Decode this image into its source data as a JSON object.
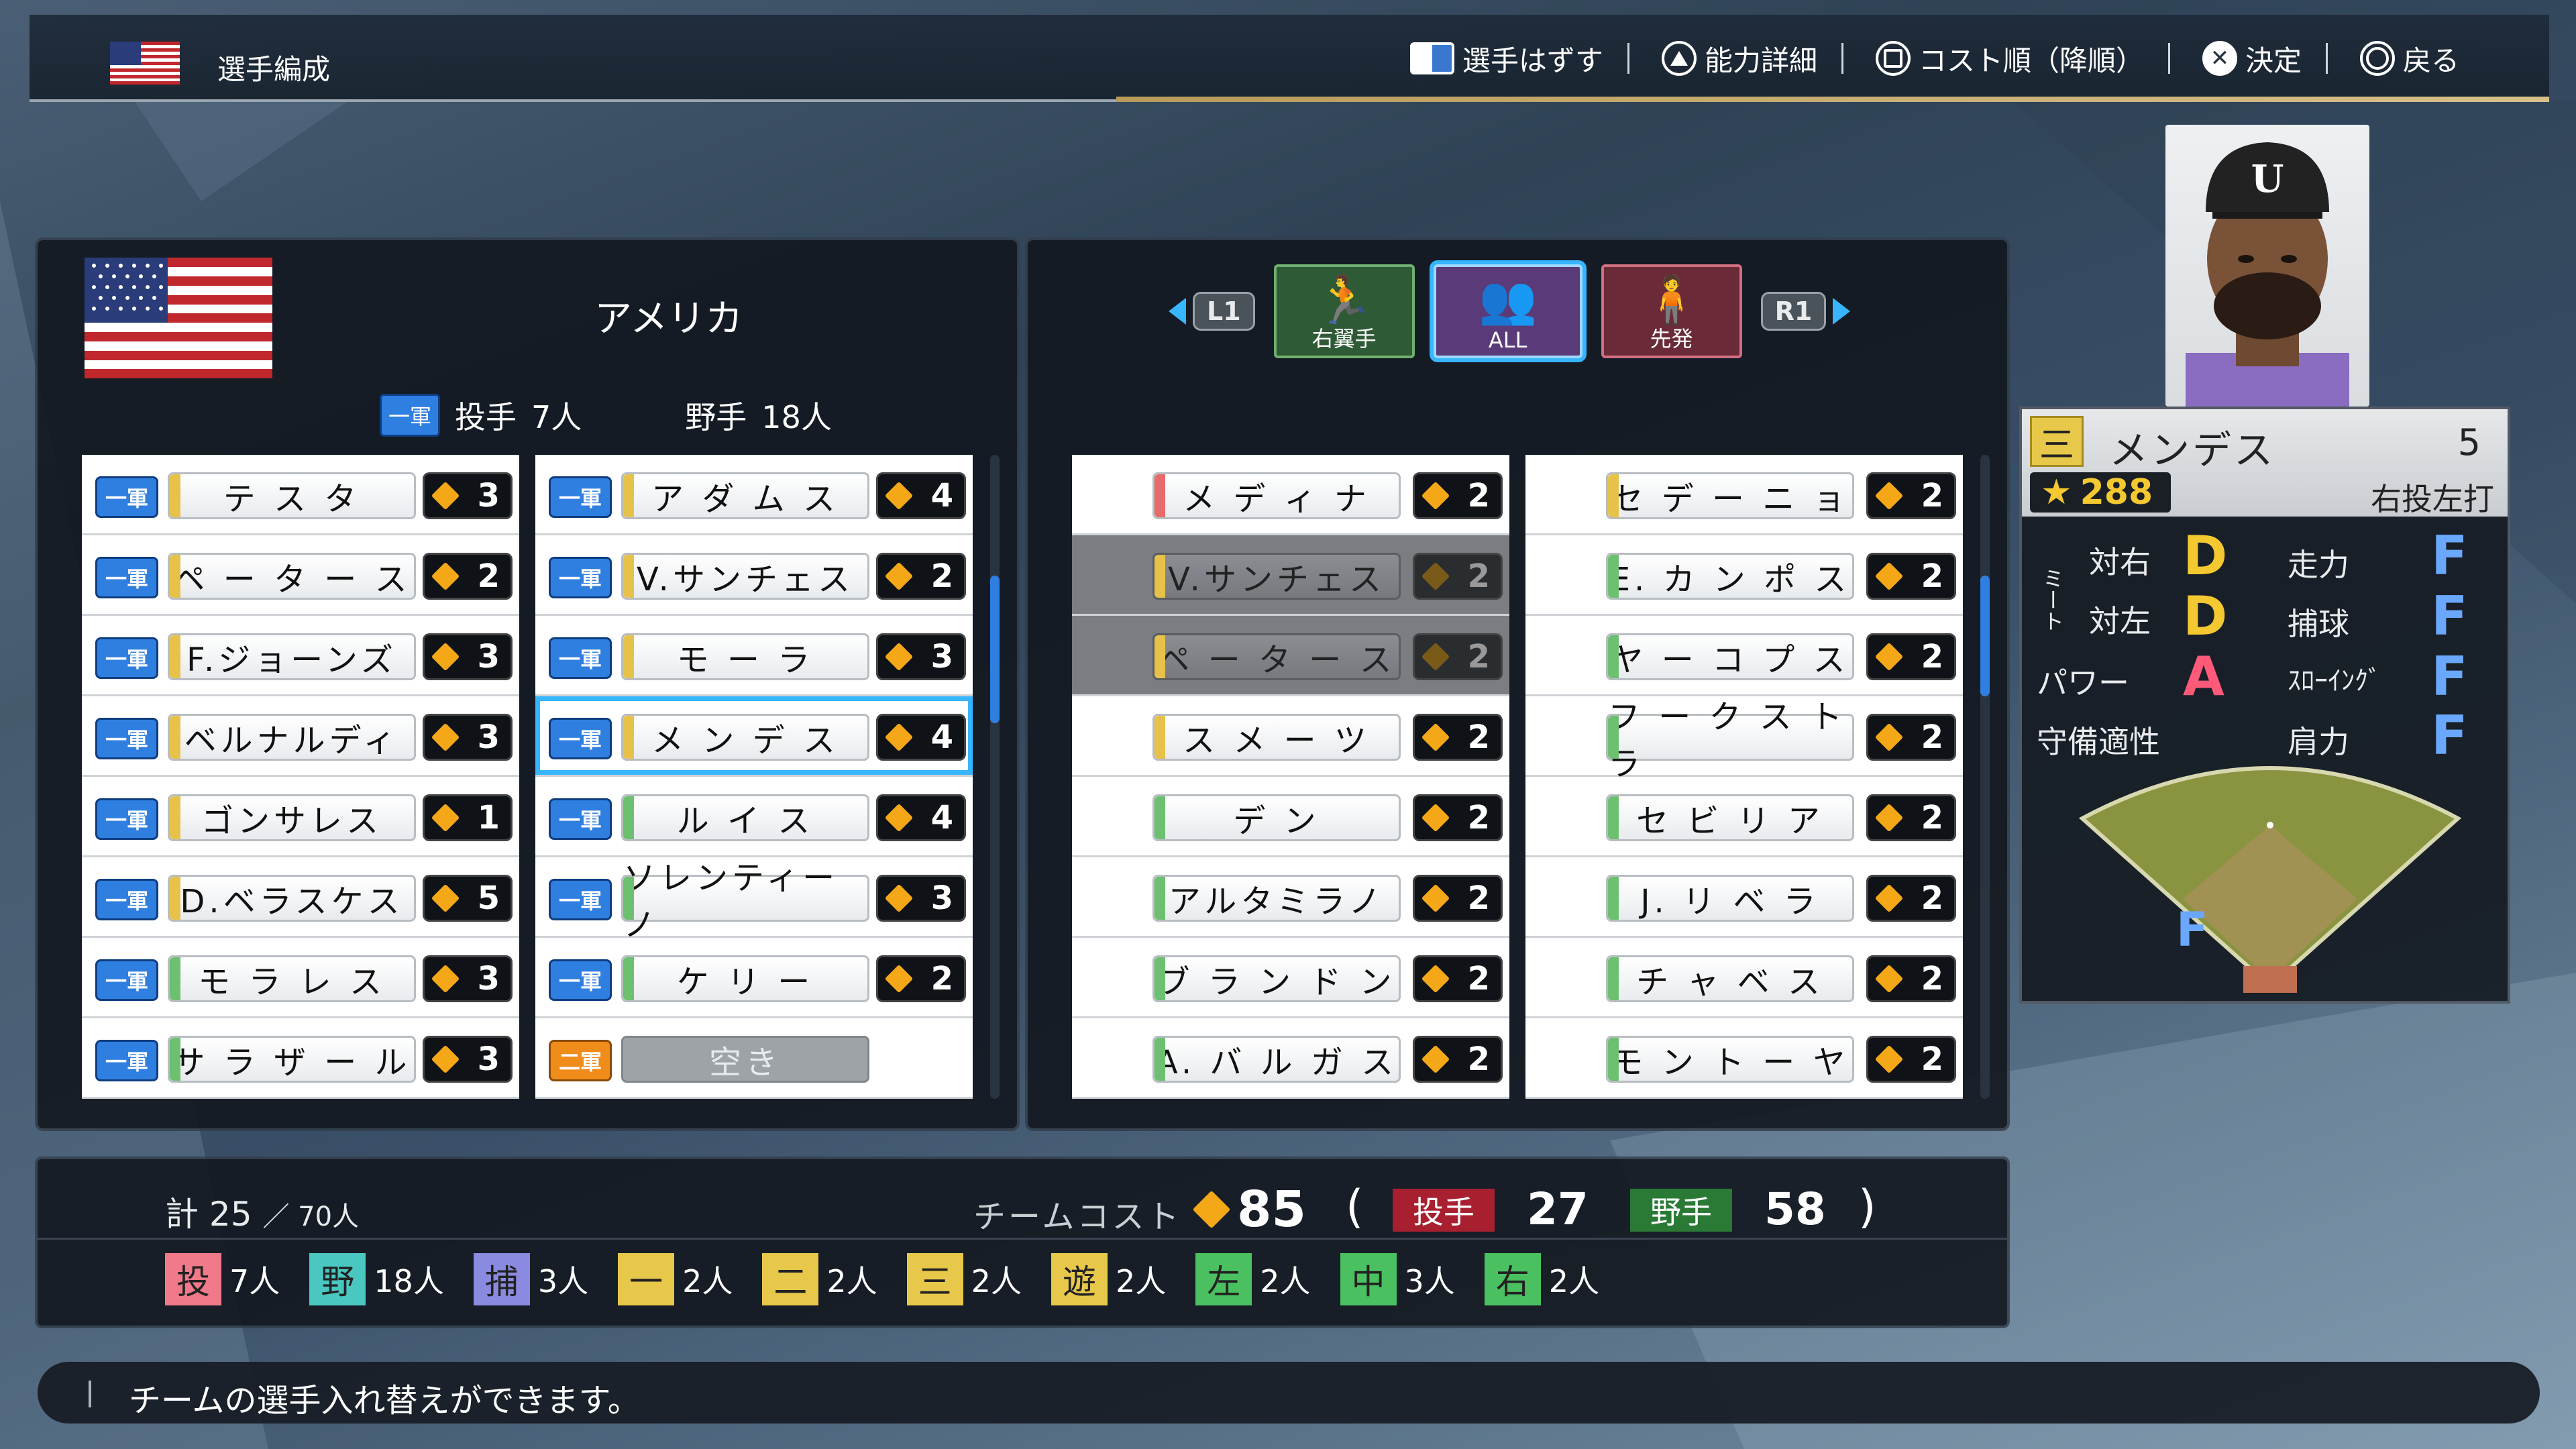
{
  "header": {
    "title": "選手編成",
    "commands": [
      {
        "glyph": "touchpad",
        "label": "選手はずす"
      },
      {
        "glyph": "triangle",
        "label": "能力詳細"
      },
      {
        "glyph": "square",
        "label": "コスト順（降順）"
      },
      {
        "glyph": "cross",
        "label": "決定"
      },
      {
        "glyph": "circle",
        "label": "戻る"
      }
    ]
  },
  "roster": {
    "country": "アメリカ",
    "group_tag": "一軍",
    "pitchers_label": "投手",
    "pitchers_count": "7人",
    "fielders_label": "野手",
    "fielders_count": "18人",
    "col1": [
      {
        "grp": "一軍",
        "name": "テ ス タ",
        "cost": "3",
        "bar": "#e7c24a"
      },
      {
        "grp": "一軍",
        "name": "ペ ー タ ー ス",
        "cost": "2",
        "bar": "#e7c24a"
      },
      {
        "grp": "一軍",
        "name": "F.ジョーンズ",
        "cost": "3",
        "bar": "#e7c24a"
      },
      {
        "grp": "一軍",
        "name": "ベルナルディ",
        "cost": "3",
        "bar": "#e7c24a"
      },
      {
        "grp": "一軍",
        "name": "ゴンサレス",
        "cost": "1",
        "bar": "#e7c24a"
      },
      {
        "grp": "一軍",
        "name": "D.ベラスケス",
        "cost": "5",
        "bar": "#e7c24a"
      },
      {
        "grp": "一軍",
        "name": "モ ラ レ ス",
        "cost": "3",
        "bar": "#6cc070"
      },
      {
        "grp": "一軍",
        "name": "サ ラ ザ ー ル",
        "cost": "3",
        "bar": "#6cc070"
      }
    ],
    "col2": [
      {
        "grp": "一軍",
        "name": "ア ダ ム ス",
        "cost": "4",
        "bar": "#e7c24a"
      },
      {
        "grp": "一軍",
        "name": "V.サンチェス",
        "cost": "2",
        "bar": "#e7c24a"
      },
      {
        "grp": "一軍",
        "name": "モ ー ラ",
        "cost": "3",
        "bar": "#e7c24a"
      },
      {
        "grp": "一軍",
        "name": "メ ン デ ス",
        "cost": "4",
        "bar": "#e7c24a",
        "selected": true
      },
      {
        "grp": "一軍",
        "name": "ル イ ス",
        "cost": "4",
        "bar": "#6cc070"
      },
      {
        "grp": "一軍",
        "name": "ソレンティーノ",
        "cost": "3",
        "bar": "#6cc070"
      },
      {
        "grp": "一軍",
        "name": "ケ リ ー",
        "cost": "2",
        "bar": "#6cc070"
      },
      {
        "grp": "二軍",
        "name": "空き",
        "cost": "",
        "empty": true
      }
    ]
  },
  "pool": {
    "tabs": {
      "left_shoulder": "L1",
      "right_shoulder": "R1",
      "items": [
        {
          "label": "右翼手",
          "icon": "🏃",
          "kind": "rh"
        },
        {
          "label": "ALL",
          "icon": "👥",
          "kind": "all"
        },
        {
          "label": "先発",
          "icon": "🧍",
          "kind": "sp"
        }
      ]
    },
    "col1": [
      {
        "name": "メ デ ィ ナ",
        "cost": "2",
        "bar": "#e86a6a"
      },
      {
        "name": "V.サンチェス",
        "cost": "2",
        "bar": "#e7c24a",
        "dim": true
      },
      {
        "name": "ペ ー タ ー ス",
        "cost": "2",
        "bar": "#e7c24a",
        "dim": true
      },
      {
        "name": "ス メ ー ツ",
        "cost": "2",
        "bar": "#e7c24a"
      },
      {
        "name": "デ ン",
        "cost": "2",
        "bar": "#6cc070"
      },
      {
        "name": "アルタミラノ",
        "cost": "2",
        "bar": "#6cc070"
      },
      {
        "name": "ブ ラ ン ド ン",
        "cost": "2",
        "bar": "#6cc070"
      },
      {
        "name": "A. バ ル ガ ス",
        "cost": "2",
        "bar": "#6cc070"
      }
    ],
    "col2": [
      {
        "name": "セ デ ー ニ ョ",
        "cost": "2",
        "bar": "#e7c24a"
      },
      {
        "name": "E. カ ン ポ ス",
        "cost": "2",
        "bar": "#6cc070"
      },
      {
        "name": "ヤ ー コ プ ス",
        "cost": "2",
        "bar": "#6cc070"
      },
      {
        "name": "フ ー ク ス ト ラ",
        "cost": "2",
        "bar": "#6cc070"
      },
      {
        "name": "セ ビ リ ア",
        "cost": "2",
        "bar": "#6cc070"
      },
      {
        "name": "J. リ ベ ラ",
        "cost": "2",
        "bar": "#6cc070"
      },
      {
        "name": "チ ャ ベ ス",
        "cost": "2",
        "bar": "#6cc070"
      },
      {
        "name": "モ ン ト ー ヤ",
        "cost": "2",
        "bar": "#6cc070"
      }
    ]
  },
  "player": {
    "position": "三",
    "name": "メンデス",
    "number": "5",
    "rating": "288",
    "hands": "右投左打",
    "stats": {
      "meet_label": "ミート",
      "vs_right_label": "対右",
      "vs_right": "D",
      "vs_left_label": "対左",
      "vs_left": "D",
      "power_label": "パワー",
      "power": "A",
      "defense_label": "守備適性",
      "speed_label": "走力",
      "speed": "F",
      "catch_label": "捕球",
      "catch": "F",
      "throw_label": "ｽﾛｰｲﾝｸﾞ",
      "throw": "F",
      "arm_label": "肩力",
      "arm": "F"
    },
    "field_grade": "F"
  },
  "summary": {
    "total_label": "計 25",
    "total_max": "／ 70人",
    "cost_label": "チームコスト",
    "cost_value": "85",
    "open_paren": "(",
    "close_paren": ")",
    "pitcher_label": "投手",
    "pitcher_cost": "27",
    "fielder_label": "野手",
    "fielder_cost": "58",
    "positions": [
      {
        "pos": "投",
        "count": "7人",
        "color": "#f07a8a"
      },
      {
        "pos": "野",
        "count": "18人",
        "color": "#4ac7c0"
      },
      {
        "pos": "捕",
        "count": "3人",
        "color": "#8a8ae0"
      },
      {
        "pos": "一",
        "count": "2人",
        "color": "#e8c84a"
      },
      {
        "pos": "二",
        "count": "2人",
        "color": "#e8c84a"
      },
      {
        "pos": "三",
        "count": "2人",
        "color": "#e8c84a"
      },
      {
        "pos": "遊",
        "count": "2人",
        "color": "#e8c84a"
      },
      {
        "pos": "左",
        "count": "2人",
        "color": "#4ac060"
      },
      {
        "pos": "中",
        "count": "3人",
        "color": "#4ac060"
      },
      {
        "pos": "右",
        "count": "2人",
        "color": "#4ac060"
      }
    ]
  },
  "message": "チームの選手入れ替えができます。"
}
